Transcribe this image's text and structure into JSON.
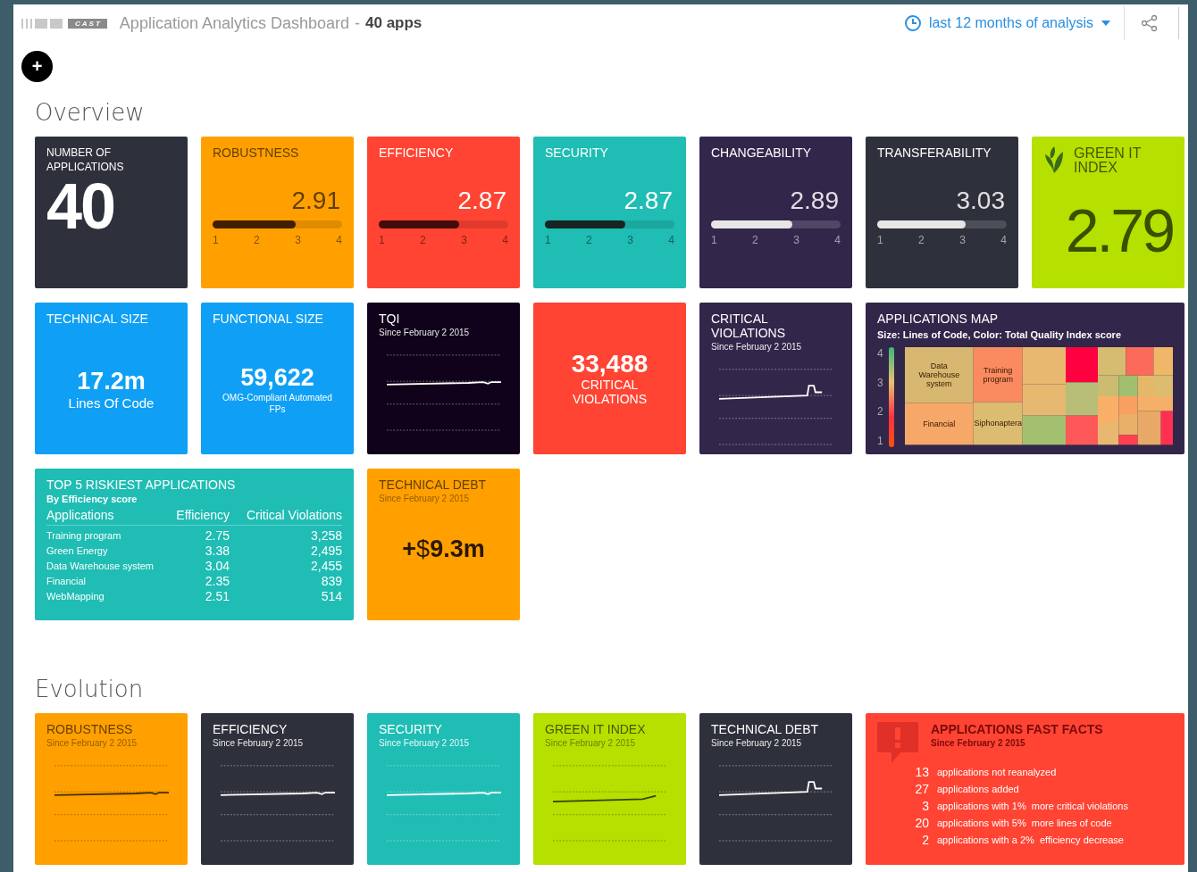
{
  "header": {
    "logo": "C A S T",
    "title": "Application Analytics Dashboard",
    "separator": "-",
    "app_count": "40 apps",
    "period": "last 12 months of analysis"
  },
  "add_button": "+",
  "sections": [
    {
      "title": "Overview",
      "cards": [
        {
          "kind": "count",
          "title": "NUMBER OF APPLICATIONS",
          "value": "40",
          "color": "#2e313b"
        },
        {
          "kind": "score",
          "title": "ROBUSTNESS",
          "value": "2.91",
          "level": 0.64,
          "ticks": [
            "1",
            "2",
            "3",
            "4"
          ],
          "color": "#ffa000"
        },
        {
          "kind": "score",
          "title": "EFFICIENCY",
          "value": "2.87",
          "level": 0.62,
          "ticks": [
            "1",
            "2",
            "3",
            "4"
          ],
          "color": "#ff4433"
        },
        {
          "kind": "score",
          "title": "SECURITY",
          "value": "2.87",
          "level": 0.62,
          "ticks": [
            "1",
            "2",
            "3",
            "4"
          ],
          "color": "#1fbdb4"
        },
        {
          "kind": "score",
          "title": "CHANGEABILITY",
          "value": "2.89",
          "level": 0.63,
          "ticks": [
            "1",
            "2",
            "3",
            "4"
          ],
          "color": "#32264a"
        },
        {
          "kind": "score",
          "title": "TRANSFERABILITY",
          "value": "3.03",
          "level": 0.68,
          "ticks": [
            "1",
            "2",
            "3",
            "4"
          ],
          "color": "#2e313b"
        },
        {
          "kind": "green",
          "title": "GREEN IT INDEX",
          "value": "2.79",
          "color": "#b5e000"
        },
        {
          "kind": "size",
          "title": "TECHNICAL SIZE",
          "value": "17.2m",
          "caption": "Lines Of Code",
          "color": "#0fa0f5"
        },
        {
          "kind": "size",
          "title": "FUNCTIONAL SIZE",
          "value": "59,622",
          "caption": "OMG-Compliant Automated FPs",
          "color": "#0fa0f5"
        },
        {
          "kind": "trend",
          "title": "TQI",
          "subtitle": "Since February 2 2015",
          "sparkline": {
            "kind": "dip"
          },
          "color": "#10021a"
        },
        {
          "kind": "total",
          "value": "33,488",
          "caption": "CRITICAL VIOLATIONS",
          "color": "#ff4433"
        },
        {
          "kind": "trend",
          "title": "CRITICAL VIOLATIONS",
          "subtitle": "Since February 2 2015",
          "sparkline": {
            "kind": "step"
          },
          "color": "#32264a"
        },
        {
          "kind": "map",
          "title": "APPLICATIONS MAP",
          "subtitle": "Size: Lines of Code, Color: Total Quality Index score",
          "scale": [
            "4",
            "3",
            "2",
            "1"
          ],
          "color": "#32264a",
          "tiles": [
            {
              "label": "Data Warehouse system",
              "color": "#d8b870"
            },
            {
              "label": "Training program",
              "color": "#fa8a60"
            },
            {
              "label": "Financial",
              "color": "#f6a868"
            },
            {
              "label": "Siphonaptera",
              "color": "#dcbc70"
            },
            {
              "color": "#e8b870"
            },
            {
              "color": "#e6b870"
            },
            {
              "color": "#a3c070"
            },
            {
              "color": "#ff0040"
            },
            {
              "color": "#b8be78"
            },
            {
              "color": "#ff5858"
            },
            {
              "color": "#d6bc70"
            },
            {
              "color": "#fb6a5a"
            },
            {
              "color": "#eeb868"
            },
            {
              "color": "#ccbc70"
            },
            {
              "color": "#a0c070"
            },
            {
              "color": "#e4b868"
            },
            {
              "color": "#dcbc70"
            },
            {
              "color": "#f8b068"
            },
            {
              "color": "#f8a060"
            },
            {
              "color": "#f4b068"
            },
            {
              "color": "#e8b870"
            },
            {
              "color": "#e8b068"
            },
            {
              "color": "#ff4050"
            },
            {
              "color": "#e8a868"
            },
            {
              "color": "#ff3050"
            }
          ]
        },
        {
          "kind": "table",
          "title": "TOP 5 RISKIEST APPLICATIONS",
          "subtitle": "By Efficiency score",
          "columns": [
            "Applications",
            "Efficiency",
            "Critical Violations"
          ],
          "color": "#1fbdb4",
          "rows": [
            [
              "Training program",
              "2.75",
              "3,258"
            ],
            [
              "Green Energy",
              "3.38",
              "2,495"
            ],
            [
              "Data Warehouse system",
              "3.04",
              "2,455"
            ],
            [
              "Financial",
              "2.35",
              "839"
            ],
            [
              "WebMapping",
              "2.51",
              "514"
            ]
          ]
        },
        {
          "kind": "money",
          "title": "TECHNICAL DEBT",
          "subtitle": "Since February 2 2015",
          "value": "**+**$**9.3m**",
          "color": "#ffa000"
        }
      ]
    },
    {
      "title": "Evolution",
      "cards": [
        {
          "kind": "trend",
          "title": "ROBUSTNESS",
          "subtitle": "Since February 2 2015",
          "sparkline": {
            "kind": "dip"
          },
          "color": "#ffa000"
        },
        {
          "kind": "trend",
          "title": "EFFICIENCY",
          "subtitle": "Since February 2 2015",
          "sparkline": {
            "kind": "dip"
          },
          "color": "#2e313b"
        },
        {
          "kind": "trend",
          "title": "SECURITY",
          "subtitle": "Since February 2 2015",
          "sparkline": {
            "kind": "dip"
          },
          "color": "#1fbdb4"
        },
        {
          "kind": "trend",
          "title": "GREEN IT INDEX",
          "subtitle": "Since February 2 2015",
          "sparkline": {
            "kind": "rise"
          },
          "color": "#b5e000"
        },
        {
          "kind": "trend",
          "title": "TECHNICAL DEBT",
          "subtitle": "Since February 2 2015",
          "sparkline": {
            "kind": "step"
          },
          "color": "#2e313b"
        },
        {
          "kind": "facts",
          "title": "APPLICATIONS FAST FACTS",
          "subtitle": "Since February 2 2015",
          "color": "#ff4433",
          "items": [
            {
              "count": "13",
              "text": "applications not reanalyzed"
            },
            {
              "count": "27",
              "text": "applications added"
            },
            {
              "count": "3",
              "text": "applications with 1%  more critical violations"
            },
            {
              "count": "20",
              "text": "applications with 5%  more lines of code"
            },
            {
              "count": "2",
              "text": "applications with a 2%  efficiency decrease"
            }
          ]
        }
      ]
    }
  ]
}
